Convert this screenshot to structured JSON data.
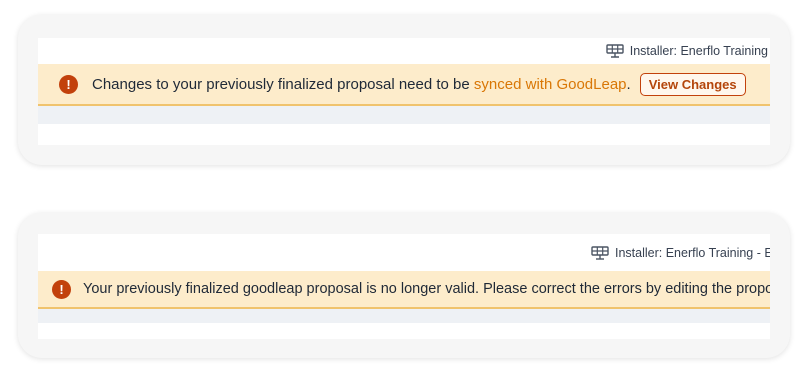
{
  "panel_1": {
    "installer_label": "Installer: Enerflo Training",
    "banner": {
      "text_before": "Changes to your previously finalized proposal need to be ",
      "link_text": "synced with GoodLeap",
      "text_after": ".",
      "button_label": "View Changes"
    }
  },
  "panel_2": {
    "installer_label": "Installer: Enerflo Training - EPC",
    "banner": {
      "text": "Your previously finalized goodleap proposal is no longer valid. Please correct the errors by editing the proposal."
    }
  },
  "icons": {
    "installer": "solar-panel-icon",
    "alert": "exclamation-circle-icon"
  },
  "colors": {
    "banner_background": "#fdeccb",
    "banner_border": "#f0c36d",
    "alert_icon": "#c2410c",
    "link": "#d97706",
    "button_border": "#c2410c"
  }
}
